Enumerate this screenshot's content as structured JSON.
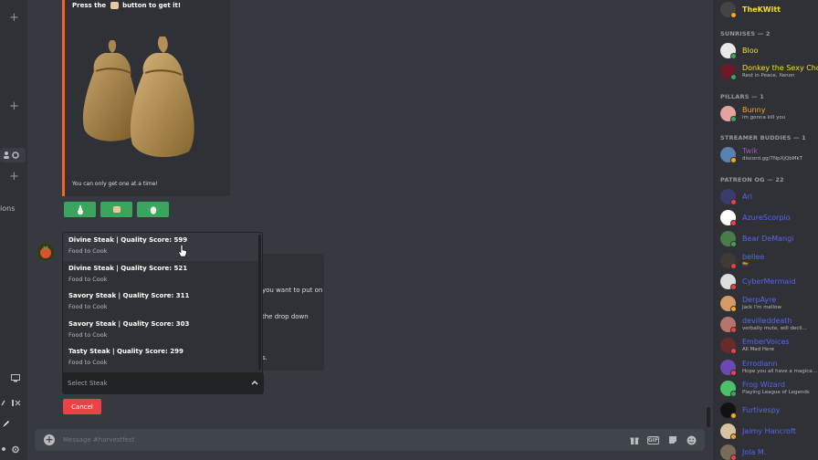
{
  "embed": {
    "title_before": "Press the",
    "title_after": "button to get it!",
    "footer": "You can only get one at a time!"
  },
  "buttons": [
    "bag-icon",
    "bread-icon",
    "egg-icon"
  ],
  "message_lines": [
    "you want to put on",
    "the drop down",
    "s."
  ],
  "dropdown": {
    "options": [
      {
        "title": "Divine Steak | Quality Score: 599",
        "desc": "Food to Cook"
      },
      {
        "title": "Divine Steak | Quality Score: 521",
        "desc": "Food to Cook"
      },
      {
        "title": "Savory Steak | Quality Score: 311",
        "desc": "Food to Cook"
      },
      {
        "title": "Savory Steak | Quality Score: 303",
        "desc": "Food to Cook"
      },
      {
        "title": "Tasty Steak | Quality Score: 299",
        "desc": "Food to Cook"
      }
    ],
    "placeholder": "Select Steak"
  },
  "cancel_label": "Cancel",
  "message_input": {
    "placeholder": "Message #harvestfest"
  },
  "left_strip": {
    "text": "ions"
  },
  "members": {
    "top_user": {
      "name": "TheKWitt",
      "color": "#f7e11a"
    },
    "groups": [
      {
        "header": "SUNRISES — 2",
        "members": [
          {
            "name": "Bloo",
            "color": "#f7e11a",
            "status": "",
            "dot": "#3ba55d",
            "avatar": "#e9e9e9"
          },
          {
            "name": "Donkey the Sexy Chonk",
            "color": "#f7e11a",
            "status": "Rest in Peace, Xenon",
            "dot": "#3ba55d",
            "avatar": "#6b1a2b"
          }
        ]
      },
      {
        "header": "PILLARS — 1",
        "members": [
          {
            "name": "Bunny",
            "color": "#faa61a",
            "status": "im gonna kill you",
            "dot": "#3ba55d",
            "avatar": "#e6a1a1"
          }
        ]
      },
      {
        "header": "STREAMER BUDDIES — 1",
        "members": [
          {
            "name": "Twik",
            "color": "#9b59b6",
            "status": "discord.gg/7NpXjQbMkT",
            "dot": "#faa61a",
            "avatar": "#5a7fb0"
          }
        ]
      },
      {
        "header": "PATREON OG — 22",
        "members": [
          {
            "name": "Ari",
            "color": "#5865f2",
            "status": "",
            "dot": "#ed4245",
            "avatar": "#3b3b6e"
          },
          {
            "name": "AzureScorpio",
            "color": "#5865f2",
            "status": "",
            "dot": "#ed4245",
            "avatar": "#ffffff"
          },
          {
            "name": "Bear DeMangi",
            "color": "#5865f2",
            "status": "",
            "dot": "#3ba55d",
            "avatar": "#4a7b4a"
          },
          {
            "name": "bellee",
            "color": "#5865f2",
            "status": "🏳️‍🌈",
            "dot": "#ed4245",
            "avatar": "#403a36"
          },
          {
            "name": "CyberMermaid",
            "color": "#5865f2",
            "status": "",
            "dot": "#ed4245",
            "avatar": "#dddddd"
          },
          {
            "name": "DerpAyre",
            "color": "#5865f2",
            "status": "Jack I'm mellow",
            "dot": "#faa61a",
            "avatar": "#d69a6a"
          },
          {
            "name": "devilleddeath",
            "color": "#5865f2",
            "status": "verbally mute, will decli...",
            "dot": "#ed4245",
            "avatar": "#b5756b"
          },
          {
            "name": "EmberVoices",
            "color": "#5865f2",
            "status": "All Mad Here",
            "dot": "#ed4245",
            "avatar": "#6a2a2a"
          },
          {
            "name": "Errodiann",
            "color": "#5865f2",
            "status": "Hope you all have a magica...",
            "dot": "#ed4245",
            "avatar": "#6a4ab0"
          },
          {
            "name": "Frog Wizard",
            "color": "#5865f2",
            "status": "Playing League of Legends",
            "dot": "#3ba55d",
            "avatar": "#4ac06a"
          },
          {
            "name": "Furtivespy",
            "color": "#5865f2",
            "status": "",
            "dot": "#faa61a",
            "avatar": "#111111"
          },
          {
            "name": "Jaimy Hancroft",
            "color": "#5865f2",
            "status": "",
            "dot": "#faa61a",
            "avatar": "#d9c2a0"
          },
          {
            "name": "Jola M.",
            "color": "#5865f2",
            "status": "",
            "dot": "#ed4245",
            "avatar": "#7a6a5a"
          }
        ]
      }
    ]
  }
}
